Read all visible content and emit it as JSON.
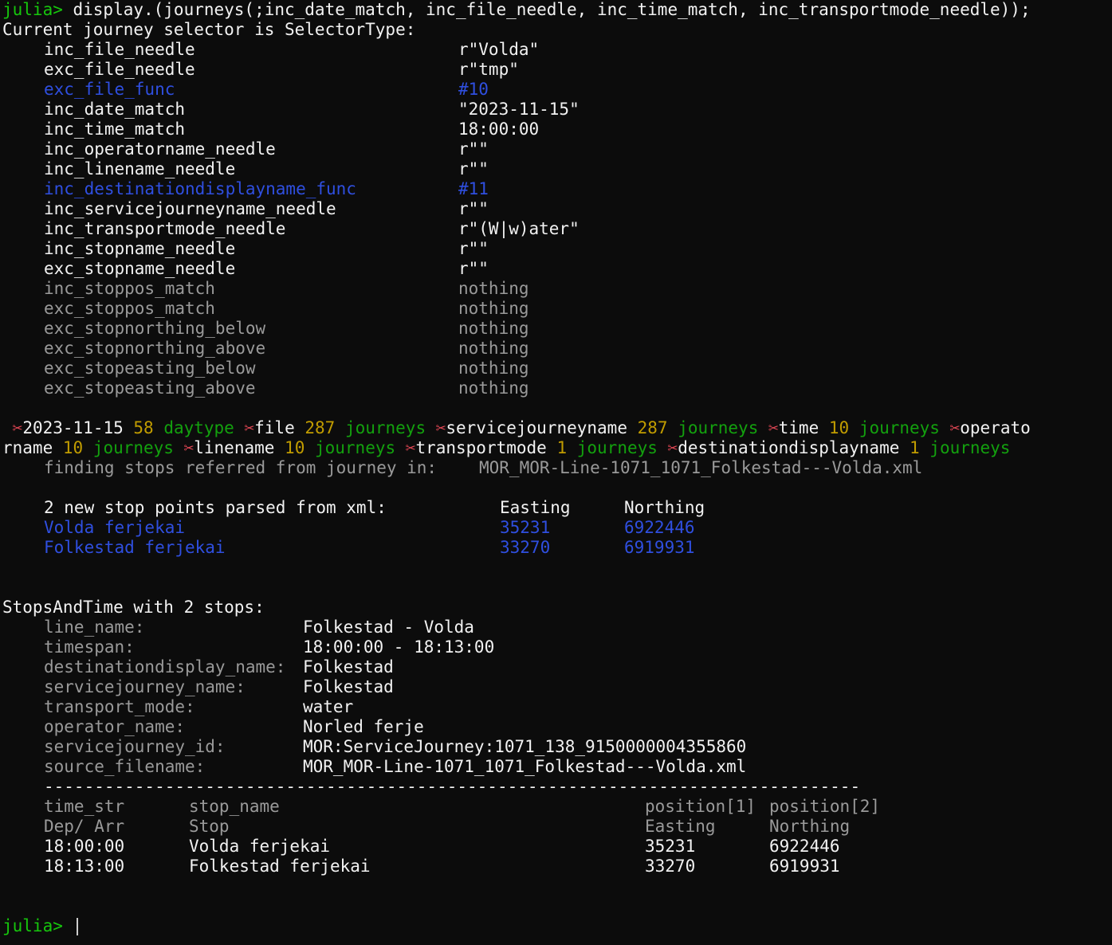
{
  "prompt": "julia>",
  "command": " display.(journeys(;inc_date_match, inc_file_needle, inc_time_match, inc_transportmode_needle));",
  "selector_header": "Current journey selector is SelectorType:",
  "selector": [
    {
      "key": "inc_file_needle",
      "value": "r\"Volda\"",
      "style": "white"
    },
    {
      "key": "exc_file_needle",
      "value": "r\"tmp\"",
      "style": "white"
    },
    {
      "key": "exc_file_func",
      "value": "#10",
      "style": "blue"
    },
    {
      "key": "inc_date_match",
      "value": "\"2023-11-15\"",
      "style": "white"
    },
    {
      "key": "inc_time_match",
      "value": "18:00:00",
      "style": "white"
    },
    {
      "key": "inc_operatorname_needle",
      "value": "r\"\"",
      "style": "white"
    },
    {
      "key": "inc_linename_needle",
      "value": "r\"\"",
      "style": "white"
    },
    {
      "key": "inc_destinationdisplayname_func",
      "value": "#11",
      "style": "blue"
    },
    {
      "key": "inc_servicejourneyname_needle",
      "value": "r\"\"",
      "style": "white"
    },
    {
      "key": "inc_transportmode_needle",
      "value": "r\"(W|w)ater\"",
      "style": "white"
    },
    {
      "key": "inc_stopname_needle",
      "value": "r\"\"",
      "style": "white"
    },
    {
      "key": "exc_stopname_needle",
      "value": "r\"\"",
      "style": "white"
    },
    {
      "key": "inc_stoppos_match",
      "value": "nothing",
      "style": "gray"
    },
    {
      "key": "exc_stoppos_match",
      "value": "nothing",
      "style": "gray"
    },
    {
      "key": "exc_stopnorthing_below",
      "value": "nothing",
      "style": "gray"
    },
    {
      "key": "exc_stopnorthing_above",
      "value": "nothing",
      "style": "gray"
    },
    {
      "key": "exc_stopeasting_below",
      "value": "nothing",
      "style": "gray"
    },
    {
      "key": "exc_stopeasting_above",
      "value": "nothing",
      "style": "gray"
    }
  ],
  "filter_progress": {
    "line1": [
      {
        "t": " ",
        "c": "white"
      },
      {
        "t": "✂",
        "c": "scissor"
      },
      {
        "t": "2023-11-15 ",
        "c": "white"
      },
      {
        "t": "58 ",
        "c": "yellow"
      },
      {
        "t": "daytype ",
        "c": "green"
      },
      {
        "t": "✂",
        "c": "scissor"
      },
      {
        "t": "file ",
        "c": "white"
      },
      {
        "t": "287 ",
        "c": "yellow"
      },
      {
        "t": "journeys ",
        "c": "green"
      },
      {
        "t": "✂",
        "c": "scissor"
      },
      {
        "t": "servicejourneyname ",
        "c": "white"
      },
      {
        "t": "287 ",
        "c": "yellow"
      },
      {
        "t": "journeys ",
        "c": "green"
      },
      {
        "t": "✂",
        "c": "scissor"
      },
      {
        "t": "time ",
        "c": "white"
      },
      {
        "t": "10 ",
        "c": "yellow"
      },
      {
        "t": "journeys ",
        "c": "green"
      },
      {
        "t": "✂",
        "c": "scissor"
      },
      {
        "t": "operato",
        "c": "white"
      }
    ],
    "line2": [
      {
        "t": "rname ",
        "c": "white"
      },
      {
        "t": "10 ",
        "c": "yellow"
      },
      {
        "t": "journeys ",
        "c": "green"
      },
      {
        "t": "✂",
        "c": "scissor"
      },
      {
        "t": "linename ",
        "c": "white"
      },
      {
        "t": "10 ",
        "c": "yellow"
      },
      {
        "t": "journeys ",
        "c": "green"
      },
      {
        "t": "✂",
        "c": "scissor"
      },
      {
        "t": "transportmode ",
        "c": "white"
      },
      {
        "t": "1 ",
        "c": "yellow"
      },
      {
        "t": "journeys ",
        "c": "green"
      },
      {
        "t": "✂",
        "c": "scissor"
      },
      {
        "t": "destinationdisplayname ",
        "c": "white"
      },
      {
        "t": "1 ",
        "c": "yellow"
      },
      {
        "t": "journeys",
        "c": "green"
      }
    ]
  },
  "finding_label": "finding stops referred from journey in:",
  "finding_file": "MOR_MOR-Line-1071_1071_Folkestad---Volda.xml",
  "parsed": {
    "header": "2 new stop points parsed from xml:",
    "col_easting": "Easting",
    "col_northing": "Northing",
    "rows": [
      {
        "name": "Volda ferjekai",
        "easting": "35231",
        "northing": "6922446"
      },
      {
        "name": "Folkestad ferjekai",
        "easting": "33270",
        "northing": "6919931"
      }
    ]
  },
  "stops_header": "StopsAndTime with 2 stops:",
  "stops_props": [
    {
      "key": "line_name:",
      "value": "Folkestad - Volda"
    },
    {
      "key": "timespan:",
      "value": "18:00:00 - 18:13:00"
    },
    {
      "key": "destinationdisplay_name:",
      "value": "Folkestad"
    },
    {
      "key": "servicejourney_name:",
      "value": "Folkestad"
    },
    {
      "key": "transport_mode:",
      "value": "water"
    },
    {
      "key": "operator_name:",
      "value": "Norled ferje"
    },
    {
      "key": "servicejourney_id:",
      "value": "MOR:ServiceJourney:1071_138_9150000004355860"
    },
    {
      "key": "source_filename:",
      "value": "MOR_MOR-Line-1071_1071_Folkestad---Volda.xml"
    }
  ],
  "separator": "---------------------------------------------------------------------------------",
  "table": {
    "header1": [
      "time_str",
      "stop_name",
      "position[1]",
      "position[2]"
    ],
    "header2": [
      "Dep/ Arr",
      "Stop",
      "Easting",
      "Northing"
    ],
    "rows": [
      [
        "18:00:00",
        "Volda ferjekai",
        "35231",
        "6922446"
      ],
      [
        "18:13:00",
        "Folkestad ferjekai",
        "33270",
        "6919931"
      ]
    ]
  },
  "final_prompt": "julia>"
}
